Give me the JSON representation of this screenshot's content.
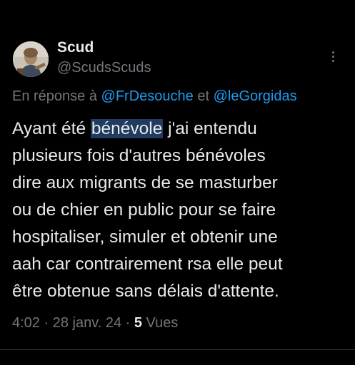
{
  "author": {
    "display_name": "Scud",
    "handle": "@ScudsScuds"
  },
  "reply": {
    "prefix": "En réponse à ",
    "mention_1": "@FrDesouche",
    "joiner": " et ",
    "mention_2": "@leGorgidas"
  },
  "tweet": {
    "line_1_pre": "Ayant été ",
    "line_1_highlight": "bénévole",
    "line_1_post": " j'ai entendu",
    "line_2": "plusieurs fois d'autres bénévoles",
    "line_3": "dire aux migrants de se masturber",
    "line_4": "ou de chier en public pour se faire",
    "line_5": "hospitaliser, simuler et obtenir une",
    "line_6": "aah car contrairement rsa elle peut",
    "line_7": "être obtenue sans délais d'attente."
  },
  "meta": {
    "time": "4:02",
    "sep_1": " · ",
    "date": "28 janv. 24",
    "sep_2": " · ",
    "views_count": "5",
    "views_label": " Vues"
  },
  "icons": {
    "more": "more-vertical-icon"
  },
  "colors": {
    "background": "#000000",
    "text": "#e7e9ea",
    "muted": "#71767b",
    "link": "#1d9bf0",
    "selection": "#213a60"
  }
}
